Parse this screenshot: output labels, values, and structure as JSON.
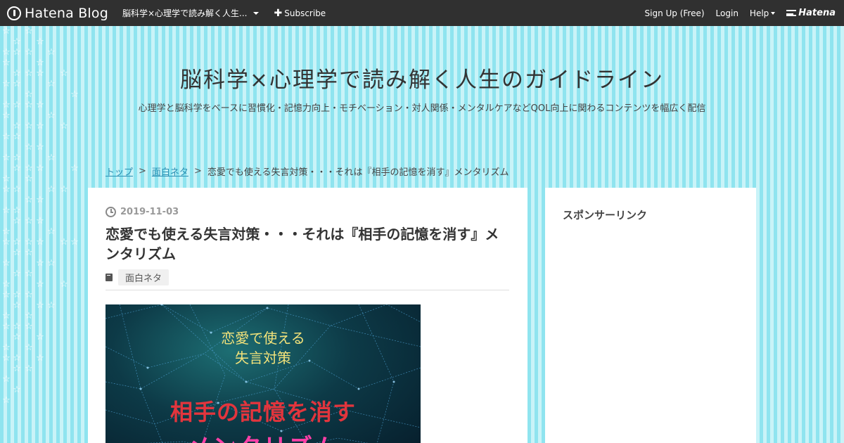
{
  "topbar": {
    "brand": "Hatena Blog",
    "blog_select": "脳科学×心理学で読み解く人生...",
    "subscribe": "Subscribe",
    "signup": "Sign Up (Free)",
    "login": "Login",
    "help": "Help",
    "hatena": "Hatena"
  },
  "header": {
    "title": "脳科学×心理学で読み解く人生のガイドライン",
    "description": "心理学と脳科学をベースに習慣化・記憶力向上・モチベーション・対人関係・メンタルケアなどQOL向上に関わるコンテンツを幅広く配信"
  },
  "breadcrumb": {
    "top": "トップ",
    "category": "面白ネタ",
    "current": "恋愛でも使える失言対策・・・それは『相手の記憶を消す』メンタリズム",
    "sep": ">"
  },
  "entry": {
    "date": "2019-11-03",
    "title": "恋愛でも使える失言対策・・・それは『相手の記憶を消す』メンタリズム",
    "category": "面白ネタ",
    "eyecatch": {
      "line1": "恋愛で使える",
      "line2": "失言対策",
      "main": "相手の記憶を消す",
      "sub": "メンタリズム"
    }
  },
  "sidebar": {
    "title": "スポンサーリンク"
  },
  "colors": {
    "topbar": "#303030",
    "stripe_a": "#8fe4ef",
    "stripe_b": "#c9f3f8",
    "link": "#2a8fb3"
  }
}
